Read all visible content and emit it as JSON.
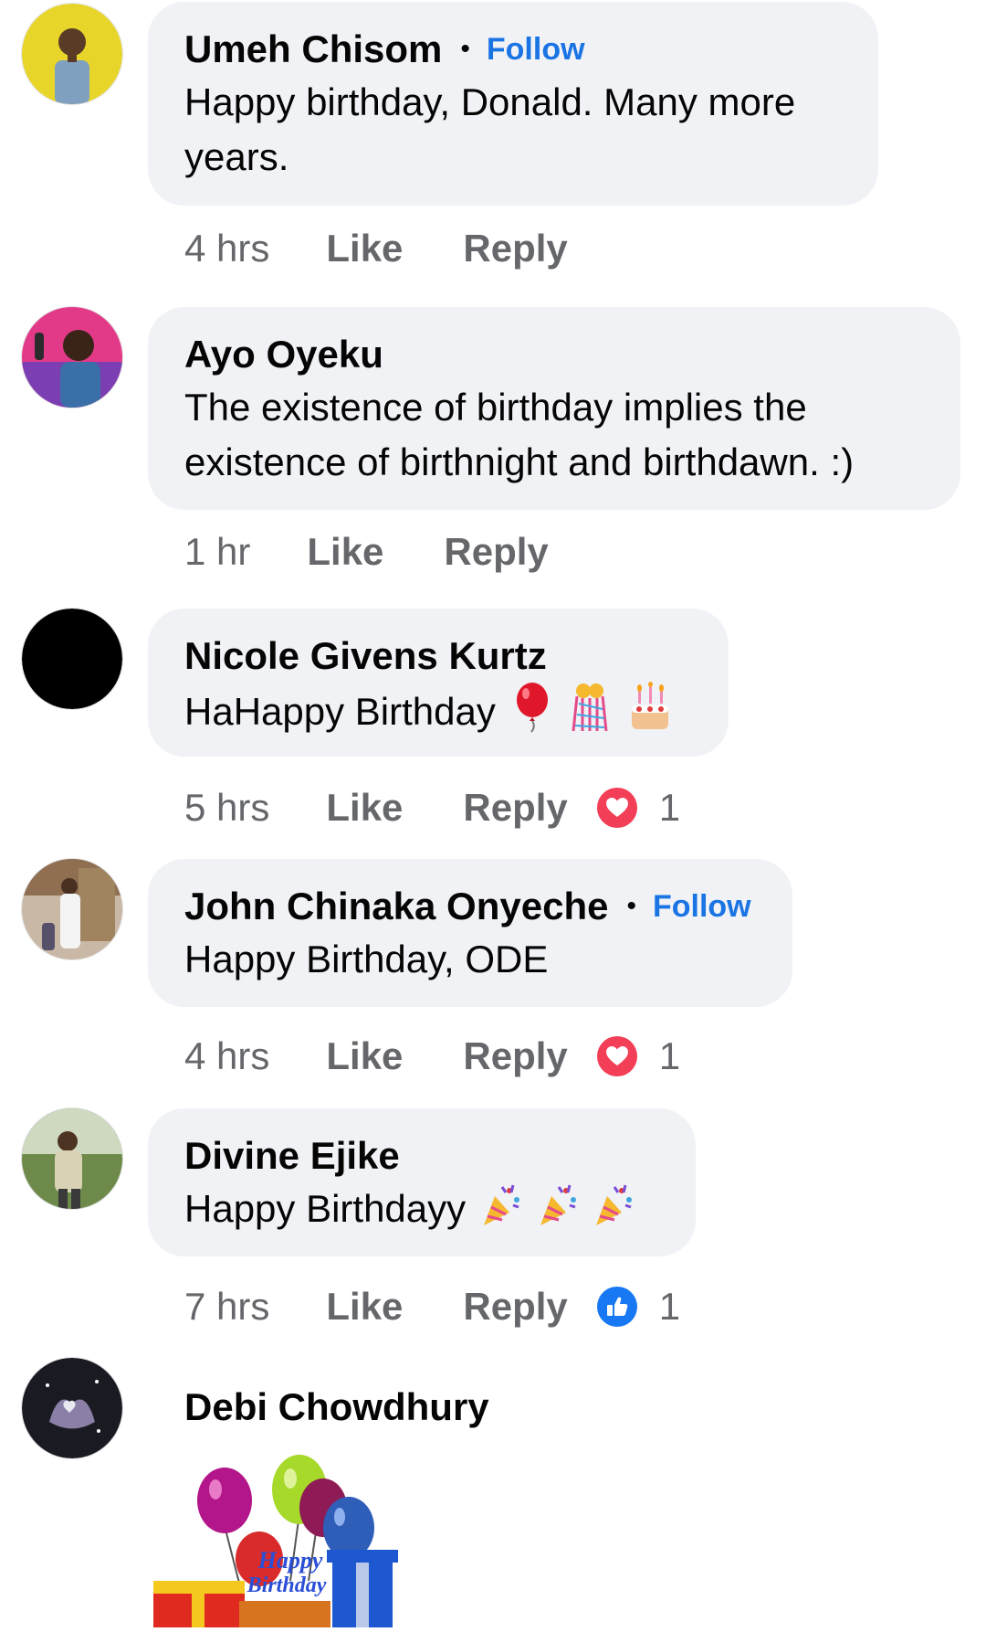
{
  "comments": [
    {
      "name": "Umeh Chisom",
      "follow": "Follow",
      "text_line1": "Happy birthday, Donald. Many more",
      "text_line2": "years.",
      "time": "4 hrs",
      "like": "Like",
      "reply": "Reply"
    },
    {
      "name": "Ayo Oyeku",
      "text_line1": "The existence of birthday implies the",
      "text_line2": "existence of birthnight and  birthdawn. :)",
      "time": "1 hr",
      "like": "Like",
      "reply": "Reply"
    },
    {
      "name": "Nicole Givens Kurtz",
      "text": "HaHappy Birthday",
      "emojis": [
        "balloon",
        "confetti-ribbon",
        "birthday-cake"
      ],
      "time": "5 hrs",
      "like": "Like",
      "reply": "Reply",
      "reaction": {
        "type": "love",
        "icon": "heart-icon",
        "count": "1",
        "color": "#f33e58"
      }
    },
    {
      "name": "John Chinaka Onyeche",
      "follow": "Follow",
      "text": "Happy Birthday, ODE",
      "time": "4 hrs",
      "like": "Like",
      "reply": "Reply",
      "reaction": {
        "type": "love",
        "icon": "heart-icon",
        "count": "1",
        "color": "#f33e58"
      }
    },
    {
      "name": "Divine Ejike",
      "text": "Happy Birthdayy",
      "emojis": [
        "party-popper",
        "party-popper",
        "party-popper"
      ],
      "time": "7 hrs",
      "like": "Like",
      "reply": "Reply",
      "reaction": {
        "type": "like",
        "icon": "thumbs-up-icon",
        "count": "1",
        "color": "#1877f2"
      }
    },
    {
      "name": "Debi Chowdhury",
      "gif": {
        "caption_line1": "Happy",
        "caption_line2": "Birthday"
      }
    }
  ],
  "colors": {
    "bubble": "#f0f2f5",
    "link": "#1b74e4",
    "meta": "#65676b",
    "love": "#f33e58",
    "like": "#1877f2"
  }
}
